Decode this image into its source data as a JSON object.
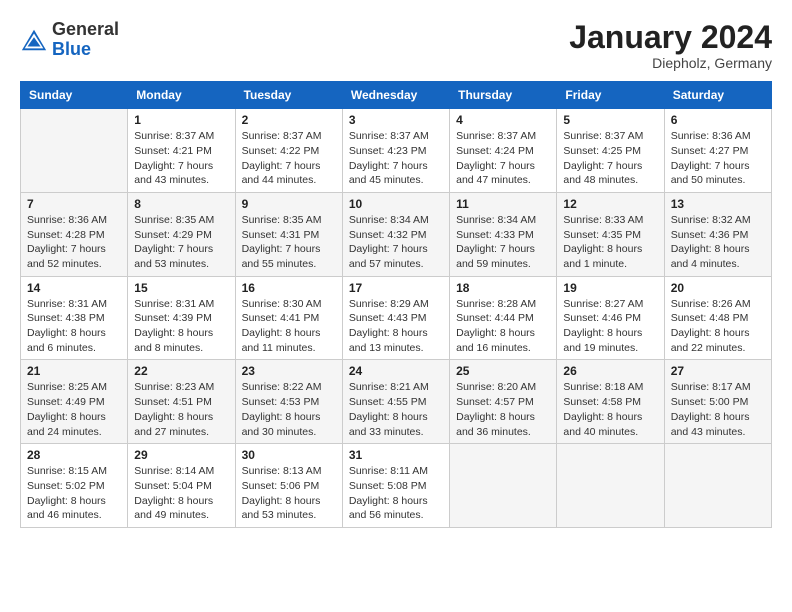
{
  "header": {
    "logo": {
      "general": "General",
      "blue": "Blue"
    },
    "title": "January 2024",
    "location": "Diepholz, Germany"
  },
  "calendar": {
    "days_of_week": [
      "Sunday",
      "Monday",
      "Tuesday",
      "Wednesday",
      "Thursday",
      "Friday",
      "Saturday"
    ],
    "weeks": [
      [
        {
          "day": "",
          "info": ""
        },
        {
          "day": "1",
          "info": "Sunrise: 8:37 AM\nSunset: 4:21 PM\nDaylight: 7 hours\nand 43 minutes."
        },
        {
          "day": "2",
          "info": "Sunrise: 8:37 AM\nSunset: 4:22 PM\nDaylight: 7 hours\nand 44 minutes."
        },
        {
          "day": "3",
          "info": "Sunrise: 8:37 AM\nSunset: 4:23 PM\nDaylight: 7 hours\nand 45 minutes."
        },
        {
          "day": "4",
          "info": "Sunrise: 8:37 AM\nSunset: 4:24 PM\nDaylight: 7 hours\nand 47 minutes."
        },
        {
          "day": "5",
          "info": "Sunrise: 8:37 AM\nSunset: 4:25 PM\nDaylight: 7 hours\nand 48 minutes."
        },
        {
          "day": "6",
          "info": "Sunrise: 8:36 AM\nSunset: 4:27 PM\nDaylight: 7 hours\nand 50 minutes."
        }
      ],
      [
        {
          "day": "7",
          "info": "Sunrise: 8:36 AM\nSunset: 4:28 PM\nDaylight: 7 hours\nand 52 minutes."
        },
        {
          "day": "8",
          "info": "Sunrise: 8:35 AM\nSunset: 4:29 PM\nDaylight: 7 hours\nand 53 minutes."
        },
        {
          "day": "9",
          "info": "Sunrise: 8:35 AM\nSunset: 4:31 PM\nDaylight: 7 hours\nand 55 minutes."
        },
        {
          "day": "10",
          "info": "Sunrise: 8:34 AM\nSunset: 4:32 PM\nDaylight: 7 hours\nand 57 minutes."
        },
        {
          "day": "11",
          "info": "Sunrise: 8:34 AM\nSunset: 4:33 PM\nDaylight: 7 hours\nand 59 minutes."
        },
        {
          "day": "12",
          "info": "Sunrise: 8:33 AM\nSunset: 4:35 PM\nDaylight: 8 hours\nand 1 minute."
        },
        {
          "day": "13",
          "info": "Sunrise: 8:32 AM\nSunset: 4:36 PM\nDaylight: 8 hours\nand 4 minutes."
        }
      ],
      [
        {
          "day": "14",
          "info": "Sunrise: 8:31 AM\nSunset: 4:38 PM\nDaylight: 8 hours\nand 6 minutes."
        },
        {
          "day": "15",
          "info": "Sunrise: 8:31 AM\nSunset: 4:39 PM\nDaylight: 8 hours\nand 8 minutes."
        },
        {
          "day": "16",
          "info": "Sunrise: 8:30 AM\nSunset: 4:41 PM\nDaylight: 8 hours\nand 11 minutes."
        },
        {
          "day": "17",
          "info": "Sunrise: 8:29 AM\nSunset: 4:43 PM\nDaylight: 8 hours\nand 13 minutes."
        },
        {
          "day": "18",
          "info": "Sunrise: 8:28 AM\nSunset: 4:44 PM\nDaylight: 8 hours\nand 16 minutes."
        },
        {
          "day": "19",
          "info": "Sunrise: 8:27 AM\nSunset: 4:46 PM\nDaylight: 8 hours\nand 19 minutes."
        },
        {
          "day": "20",
          "info": "Sunrise: 8:26 AM\nSunset: 4:48 PM\nDaylight: 8 hours\nand 22 minutes."
        }
      ],
      [
        {
          "day": "21",
          "info": "Sunrise: 8:25 AM\nSunset: 4:49 PM\nDaylight: 8 hours\nand 24 minutes."
        },
        {
          "day": "22",
          "info": "Sunrise: 8:23 AM\nSunset: 4:51 PM\nDaylight: 8 hours\nand 27 minutes."
        },
        {
          "day": "23",
          "info": "Sunrise: 8:22 AM\nSunset: 4:53 PM\nDaylight: 8 hours\nand 30 minutes."
        },
        {
          "day": "24",
          "info": "Sunrise: 8:21 AM\nSunset: 4:55 PM\nDaylight: 8 hours\nand 33 minutes."
        },
        {
          "day": "25",
          "info": "Sunrise: 8:20 AM\nSunset: 4:57 PM\nDaylight: 8 hours\nand 36 minutes."
        },
        {
          "day": "26",
          "info": "Sunrise: 8:18 AM\nSunset: 4:58 PM\nDaylight: 8 hours\nand 40 minutes."
        },
        {
          "day": "27",
          "info": "Sunrise: 8:17 AM\nSunset: 5:00 PM\nDaylight: 8 hours\nand 43 minutes."
        }
      ],
      [
        {
          "day": "28",
          "info": "Sunrise: 8:15 AM\nSunset: 5:02 PM\nDaylight: 8 hours\nand 46 minutes."
        },
        {
          "day": "29",
          "info": "Sunrise: 8:14 AM\nSunset: 5:04 PM\nDaylight: 8 hours\nand 49 minutes."
        },
        {
          "day": "30",
          "info": "Sunrise: 8:13 AM\nSunset: 5:06 PM\nDaylight: 8 hours\nand 53 minutes."
        },
        {
          "day": "31",
          "info": "Sunrise: 8:11 AM\nSunset: 5:08 PM\nDaylight: 8 hours\nand 56 minutes."
        },
        {
          "day": "",
          "info": ""
        },
        {
          "day": "",
          "info": ""
        },
        {
          "day": "",
          "info": ""
        }
      ]
    ]
  }
}
